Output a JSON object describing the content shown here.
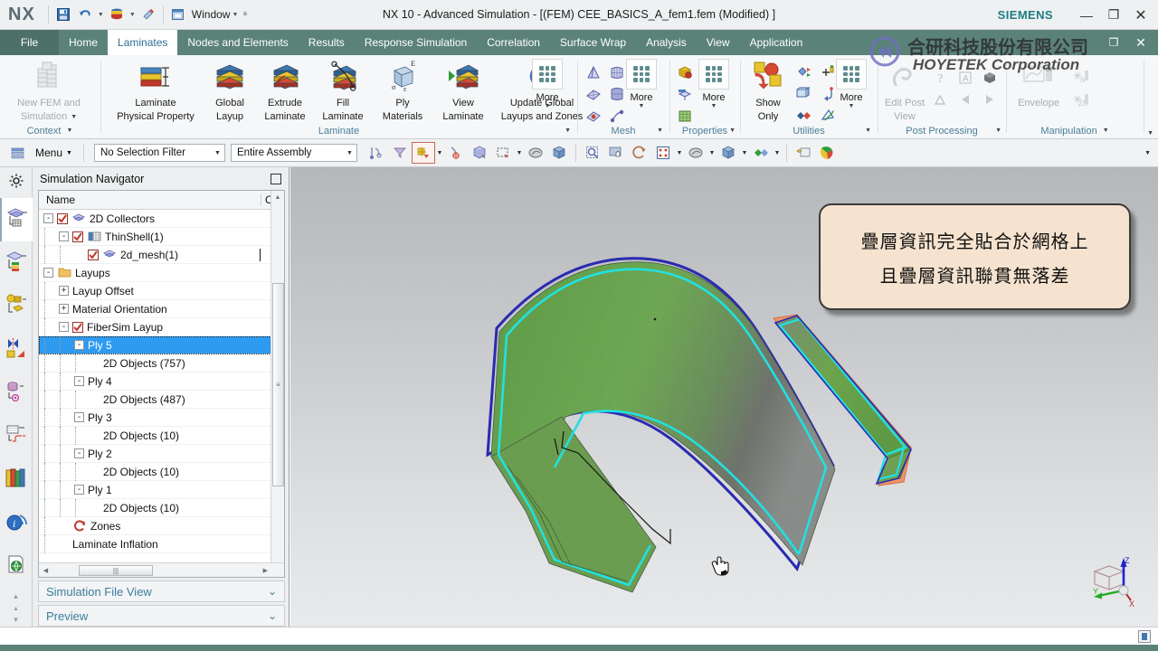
{
  "titlebar": {
    "logo": "NX",
    "window_menu": "Window",
    "title": "NX 10 - Advanced Simulation - [(FEM) CEE_BASICS_A_fem1.fem (Modified) ]",
    "brand": "SIEMENS",
    "quick_icons": [
      "save-icon",
      "undo-icon",
      "layers-icon",
      "paint-icon",
      "window-icon"
    ],
    "window_controls": [
      "minimize-icon",
      "maximize-icon",
      "close-icon"
    ],
    "doc_controls": [
      "restore-icon",
      "close-doc-icon"
    ]
  },
  "tabs": [
    {
      "label": "File",
      "active": false
    },
    {
      "label": "Home",
      "active": false
    },
    {
      "label": "Laminates",
      "active": true
    },
    {
      "label": "Nodes and Elements",
      "active": false
    },
    {
      "label": "Results",
      "active": false
    },
    {
      "label": "Response Simulation",
      "active": false
    },
    {
      "label": "Correlation",
      "active": false
    },
    {
      "label": "Surface Wrap",
      "active": false
    },
    {
      "label": "Analysis",
      "active": false
    },
    {
      "label": "View",
      "active": false
    },
    {
      "label": "Application",
      "active": false
    }
  ],
  "ribbon": {
    "groups": [
      {
        "name": "Context",
        "label": "Context",
        "buttons": [
          {
            "label_line1": "New FEM and",
            "label_line2": "Simulation",
            "icon": "new-fem-icon",
            "disabled": true,
            "dropdown": true
          }
        ]
      },
      {
        "name": "Laminate",
        "label": "Laminate",
        "buttons": [
          {
            "label_line1": "Laminate",
            "label_line2": "Physical Property",
            "icon": "laminate-physical-property-icon"
          },
          {
            "label_line1": "Global",
            "label_line2": "Layup",
            "icon": "global-layup-icon"
          },
          {
            "label_line1": "Extrude",
            "label_line2": "Laminate",
            "icon": "extrude-laminate-icon"
          },
          {
            "label_line1": "Fill",
            "label_line2": "Laminate",
            "icon": "fill-laminate-icon"
          },
          {
            "label_line1": "Ply",
            "label_line2": "Materials",
            "icon": "ply-materials-icon"
          },
          {
            "label_line1": "View",
            "label_line2": "Laminate",
            "icon": "view-laminate-icon"
          },
          {
            "label_line1": "Update Global",
            "label_line2": "Layups and Zones",
            "icon": "update-global-layups-icon"
          },
          {
            "label_line1": "More",
            "label_line2": "",
            "icon": "more-grid-icon",
            "dropdown": true
          }
        ]
      },
      {
        "name": "Mesh",
        "label": "Mesh",
        "more_label": "More"
      },
      {
        "name": "Properties",
        "label": "Properties",
        "more_label": "More"
      },
      {
        "name": "Utilities",
        "label": "Utilities",
        "more_label": "More",
        "buttons": [
          {
            "label_line1": "Show",
            "label_line2": "Only",
            "icon": "show-only-icon"
          }
        ]
      },
      {
        "name": "Post Processing",
        "label": "Post Processing",
        "buttons": [
          {
            "label_line1": "Edit Post",
            "label_line2": "View",
            "icon": "edit-post-view-icon",
            "disabled": true
          }
        ]
      },
      {
        "name": "Manipulation",
        "label": "Manipulation",
        "buttons": [
          {
            "label_line1": "Envelope",
            "label_line2": "",
            "icon": "envelope-icon",
            "disabled": true
          }
        ]
      }
    ]
  },
  "seltoolbar": {
    "menu_label": "Menu",
    "selection_filter": {
      "value": "No Selection Filter"
    },
    "scope": {
      "value": "Entire Assembly"
    },
    "icons": [
      "snap-point-icon",
      "filter-icon",
      "selection-priority-icon",
      "point-on-curve-icon",
      "face-select-icon",
      "rectangle-select-icon",
      "shaded-icon",
      "solid-icon",
      "zoom-fit-icon",
      "pan-icon",
      "rotate-icon",
      "grid-icon",
      "shading-style-icon",
      "view-cube-icon",
      "render-style-icon",
      "clip-icon",
      "color-icon"
    ]
  },
  "rail": {
    "items": [
      {
        "name": "settings-gear-icon",
        "selected": false
      },
      {
        "name": "simulation-navigator-icon",
        "selected": true
      },
      {
        "name": "post-processing-navigator-icon",
        "selected": false
      },
      {
        "name": "assembly-navigator-icon",
        "selected": false
      },
      {
        "name": "constraint-navigator-icon",
        "selected": false
      },
      {
        "name": "part-navigator-icon",
        "selected": false
      },
      {
        "name": "reuse-library-icon",
        "selected": false
      },
      {
        "name": "system-materials-icon",
        "selected": false
      },
      {
        "name": "help-info-icon",
        "selected": false
      },
      {
        "name": "web-browser-icon",
        "selected": false
      }
    ]
  },
  "navigator": {
    "title": "Simulation Navigator",
    "columns": [
      "Name",
      "Co"
    ],
    "rows": [
      {
        "label": "2D Collectors",
        "indent": 0,
        "toggle": "-",
        "checkbox": true,
        "icon": "mesh-collector-icon",
        "selected": false
      },
      {
        "label": "ThinShell(1)",
        "indent": 1,
        "toggle": "-",
        "checkbox": true,
        "icon": "thin-shell-icon",
        "selected": false
      },
      {
        "label": "2d_mesh(1)",
        "indent": 2,
        "toggle": "",
        "checkbox": true,
        "icon": "mesh-icon",
        "selected": false
      },
      {
        "label": "Layups",
        "indent": 0,
        "toggle": "-",
        "checkbox": false,
        "icon": "folder-icon",
        "selected": false
      },
      {
        "label": "Layup Offset",
        "indent": 1,
        "toggle": "+",
        "checkbox": false,
        "icon": "",
        "selected": false
      },
      {
        "label": "Material Orientation",
        "indent": 1,
        "toggle": "+",
        "checkbox": false,
        "icon": "",
        "selected": false
      },
      {
        "label": "FiberSim Layup",
        "indent": 1,
        "toggle": "-",
        "checkbox": true,
        "icon": "",
        "selected": false
      },
      {
        "label": "Ply 5",
        "indent": 2,
        "toggle": "-",
        "checkbox": false,
        "icon": "",
        "selected": true
      },
      {
        "label": "2D Objects (757)",
        "indent": 3,
        "toggle": "",
        "checkbox": false,
        "icon": "",
        "selected": false
      },
      {
        "label": "Ply 4",
        "indent": 2,
        "toggle": "-",
        "checkbox": false,
        "icon": "",
        "selected": false
      },
      {
        "label": "2D Objects (487)",
        "indent": 3,
        "toggle": "",
        "checkbox": false,
        "icon": "",
        "selected": false
      },
      {
        "label": "Ply 3",
        "indent": 2,
        "toggle": "-",
        "checkbox": false,
        "icon": "",
        "selected": false
      },
      {
        "label": "2D Objects (10)",
        "indent": 3,
        "toggle": "",
        "checkbox": false,
        "icon": "",
        "selected": false
      },
      {
        "label": "Ply 2",
        "indent": 2,
        "toggle": "-",
        "checkbox": false,
        "icon": "",
        "selected": false
      },
      {
        "label": "2D Objects (10)",
        "indent": 3,
        "toggle": "",
        "checkbox": false,
        "icon": "",
        "selected": false
      },
      {
        "label": "Ply 1",
        "indent": 2,
        "toggle": "-",
        "checkbox": false,
        "icon": "",
        "selected": false
      },
      {
        "label": "2D Objects (10)",
        "indent": 3,
        "toggle": "",
        "checkbox": false,
        "icon": "",
        "selected": false
      },
      {
        "label": "Zones",
        "indent": 1,
        "toggle": "",
        "checkbox": false,
        "icon": "zones-icon",
        "selected": false
      },
      {
        "label": "Laminate Inflation",
        "indent": 1,
        "toggle": "",
        "checkbox": false,
        "icon": "",
        "selected": false
      }
    ],
    "panels": [
      {
        "label": "Simulation File View",
        "chevron": "⌄"
      },
      {
        "label": "Preview",
        "chevron": "⌄"
      }
    ]
  },
  "viewport": {
    "callout": {
      "line1": "疊層資訊完全貼合於網格上",
      "line2": "且疊層資訊聯貫無落差",
      "bg_color": "#f6e3cf",
      "border_color": "#3a3a3a"
    },
    "model": {
      "name": "curved-composite-shell-mesh",
      "surface_color": "#6aa84f",
      "edge_color": "#22e0e0",
      "underside_color": "#f2936a",
      "outline_color": "#2a2ab0"
    },
    "triad": {
      "axes": [
        "Z",
        "Y",
        "X"
      ],
      "z_color": "#2222cc",
      "y_color": "#22aa22"
    },
    "cursor": "pan-hand-cursor"
  },
  "watermark": {
    "chinese": "合研科技股份有限公司",
    "english": "HOYETEK Corporation",
    "mark_color": "#6f6fc4"
  },
  "statusbar": {
    "icon": "view-section-icon"
  }
}
